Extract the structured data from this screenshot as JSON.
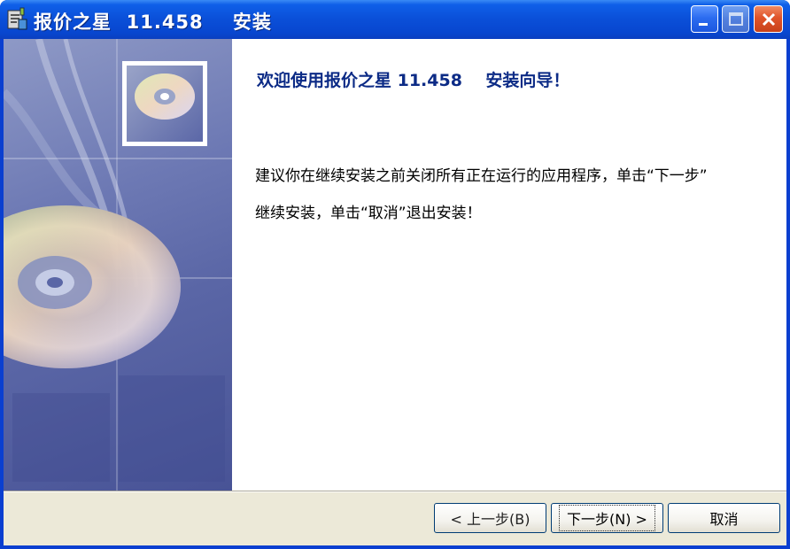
{
  "window": {
    "title": "报价之星  11.458    安装"
  },
  "wizard": {
    "heading": "欢迎使用报价之星 11.458    安装向导！",
    "body_line1": "建议你在继续安装之前关闭所有正在运行的应用程序，单击“下一步”",
    "body_line2": "继续安装，单击“取消”退出安装！"
  },
  "buttons": {
    "back_label": "< 上一步(B)",
    "next_label": "下一步(N) >",
    "cancel_label": "取消"
  },
  "colors": {
    "titlebar": "#0a4fd8",
    "heading": "#0c2b86",
    "side_panel": "#6d79b4",
    "close_button": "#e0542a"
  },
  "icons": {
    "app": "installer-icon",
    "minimize": "minimize-icon",
    "maximize": "maximize-icon",
    "close": "close-icon",
    "disc": "cd-disc-icon"
  }
}
